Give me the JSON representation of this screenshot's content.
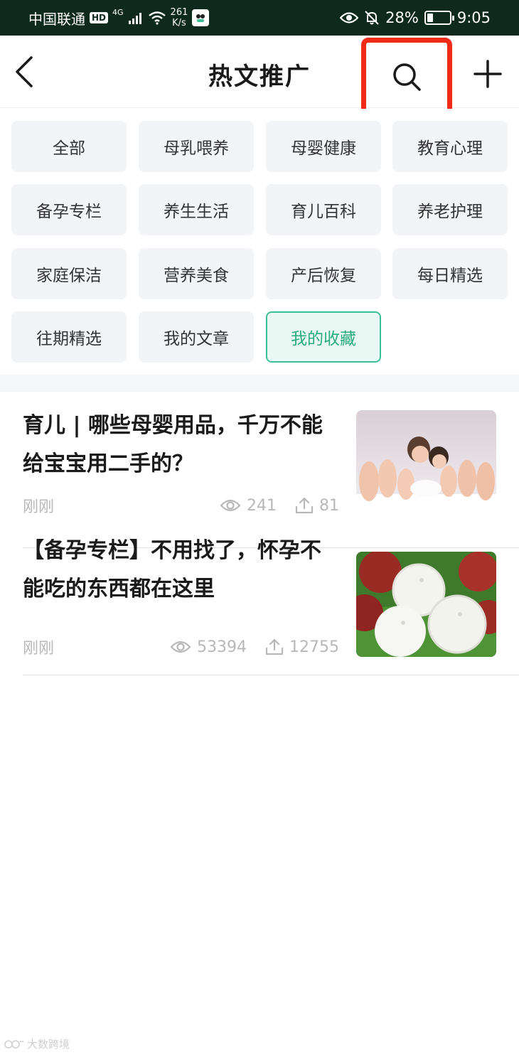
{
  "status_bar": {
    "carrier": "中国联通",
    "hd_badge": "HD",
    "network_type": "4G",
    "net_speed_value": "261",
    "net_speed_unit": "K/s",
    "battery_percent": "28%",
    "battery_level": 0.28,
    "time": "9:05"
  },
  "header": {
    "title": "热文推广",
    "back_icon": "chevron-left-icon",
    "search_icon": "search-icon",
    "add_icon": "plus-icon",
    "highlight_color": "#ef2a16"
  },
  "categories": {
    "items": [
      {
        "label": "全部"
      },
      {
        "label": "母乳喂养"
      },
      {
        "label": "母婴健康"
      },
      {
        "label": "教育心理"
      },
      {
        "label": "备孕专栏"
      },
      {
        "label": "养生生活"
      },
      {
        "label": "育儿百科"
      },
      {
        "label": "养老护理"
      },
      {
        "label": "家庭保洁"
      },
      {
        "label": "营养美食"
      },
      {
        "label": "产后恢复"
      },
      {
        "label": "每日精选"
      },
      {
        "label": "往期精选"
      },
      {
        "label": "我的文章"
      },
      {
        "label": "我的收藏",
        "selected": true
      }
    ],
    "active_color": "#28ac7f"
  },
  "articles": [
    {
      "title": "育儿 | 哪些母婴用品，千万不能给宝宝用二手的？",
      "time": "刚刚",
      "views": "241",
      "shares": "81",
      "thumbnail": "family-feet-photo"
    },
    {
      "title": "【备孕专栏】不用找了，怀孕不能吃的东西都在这里",
      "time": "刚刚",
      "views": "53394",
      "shares": "12755",
      "thumbnail": "lychee-photo"
    }
  ],
  "watermark": {
    "text": "大数跨境"
  }
}
